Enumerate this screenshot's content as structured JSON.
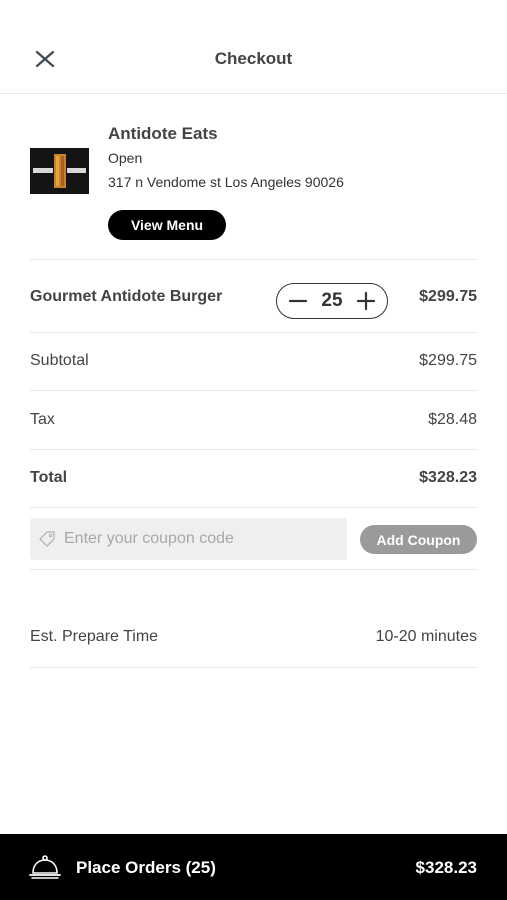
{
  "header": {
    "title": "Checkout",
    "close_icon": "close-icon"
  },
  "restaurant": {
    "name": "Antidote Eats",
    "status": "Open",
    "address": "317 n Vendome st Los Angeles 90026",
    "view_menu_label": "View Menu",
    "logo_text": "ANTIDOTE EATS"
  },
  "cart": {
    "item_name": "Gourmet Antidote Burger",
    "quantity": "25",
    "item_price": "$299.75",
    "minus_icon": "minus-icon",
    "plus_icon": "plus-icon"
  },
  "summary": {
    "subtotal_label": "Subtotal",
    "subtotal_value": "$299.75",
    "tax_label": "Tax",
    "tax_value": "$28.48",
    "total_label": "Total",
    "total_value": "$328.23"
  },
  "coupon": {
    "placeholder": "Enter your coupon code",
    "value": "",
    "button_label": "Add Coupon",
    "icon": "tag-icon"
  },
  "prep": {
    "label": "Est. Prepare Time",
    "value": "10-20 minutes"
  },
  "footer": {
    "label": "Place Orders (25)",
    "total": "$328.23",
    "icon": "service-bell-icon"
  },
  "colors": {
    "footer_bg": "#000000",
    "view_menu_bg": "#000000",
    "add_coupon_bg": "#9a9a9a",
    "coupon_field_bg": "#efefef",
    "divider": "#e6e6e6"
  }
}
